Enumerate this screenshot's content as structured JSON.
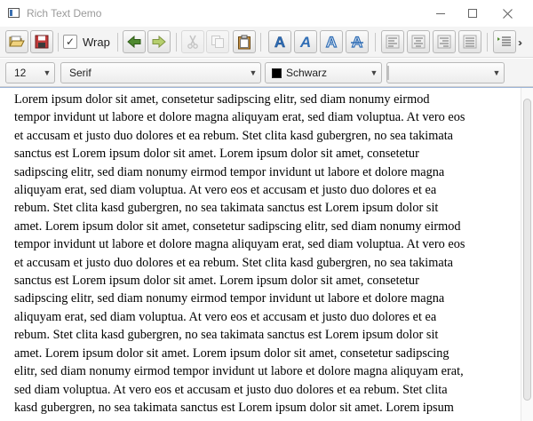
{
  "window": {
    "title": "Rich Text Demo",
    "controls": [
      "minimize-icon",
      "maximize-icon",
      "close-icon"
    ]
  },
  "toolbar": {
    "wrap_label": "Wrap",
    "wrap_checked": true,
    "buttons": [
      {
        "name": "open-button",
        "icon": "folder-open-icon"
      },
      {
        "name": "save-button",
        "icon": "save-icon"
      },
      {
        "name": "undo-button",
        "icon": "undo-icon"
      },
      {
        "name": "redo-button",
        "icon": "redo-icon"
      },
      {
        "name": "cut-button",
        "icon": "cut-icon",
        "disabled": true
      },
      {
        "name": "copy-button",
        "icon": "copy-icon",
        "disabled": true
      },
      {
        "name": "paste-button",
        "icon": "paste-icon"
      },
      {
        "name": "bold-button",
        "icon": "bold-icon"
      },
      {
        "name": "italic-button",
        "icon": "italic-icon"
      },
      {
        "name": "outline-button",
        "icon": "outline-icon"
      },
      {
        "name": "strikethrough-button",
        "icon": "strikethrough-icon"
      },
      {
        "name": "align-left-button",
        "icon": "align-left-icon"
      },
      {
        "name": "align-center-button",
        "icon": "align-center-icon"
      },
      {
        "name": "align-right-button",
        "icon": "align-right-icon"
      },
      {
        "name": "align-justify-button",
        "icon": "align-justify-icon"
      },
      {
        "name": "list-button",
        "icon": "list-icon"
      }
    ],
    "overflow_icon": "chevron-double-right-icon"
  },
  "format_bar": {
    "font_size": "12",
    "font_family": "Serif",
    "text_color": "Schwarz",
    "text_color_hex": "#000000",
    "background_color": ""
  },
  "colors": {
    "accent_blue": "#2f6db5",
    "green": "#4f8a2f",
    "chrome": "#f4f4f4"
  },
  "editor": {
    "text": "Lorem ipsum dolor sit amet, consetetur sadipscing elitr, sed diam nonumy eirmod\ntempor invidunt ut labore et dolore magna aliquyam erat, sed diam voluptua. At vero eos\net accusam et justo duo dolores et ea rebum. Stet clita kasd gubergren, no sea takimata\nsanctus est Lorem ipsum dolor sit amet. Lorem ipsum dolor sit amet, consetetur\nsadipscing elitr, sed diam nonumy eirmod tempor invidunt ut labore et dolore magna\naliquyam erat, sed diam voluptua. At vero eos et accusam et justo duo dolores et ea\nrebum. Stet clita kasd gubergren, no sea takimata sanctus est Lorem ipsum dolor sit\namet. Lorem ipsum dolor sit amet, consetetur sadipscing elitr, sed diam nonumy eirmod\ntempor invidunt ut labore et dolore magna aliquyam erat, sed diam voluptua. At vero eos\net accusam et justo duo dolores et ea rebum. Stet clita kasd gubergren, no sea takimata\nsanctus est Lorem ipsum dolor sit amet. Lorem ipsum dolor sit amet, consetetur\nsadipscing elitr, sed diam nonumy eirmod tempor invidunt ut labore et dolore magna\naliquyam erat, sed diam voluptua. At vero eos et accusam et justo duo dolores et ea\nrebum. Stet clita kasd gubergren, no sea takimata sanctus est Lorem ipsum dolor sit\namet. Lorem ipsum dolor sit amet. Lorem ipsum dolor sit amet, consetetur sadipscing\nelitr, sed diam nonumy eirmod tempor invidunt ut labore et dolore magna aliquyam erat,\nsed diam voluptua. At vero eos et accusam et justo duo dolores et ea rebum. Stet clita\nkasd gubergren, no sea takimata sanctus est Lorem ipsum dolor sit amet. Lorem ipsum"
  }
}
